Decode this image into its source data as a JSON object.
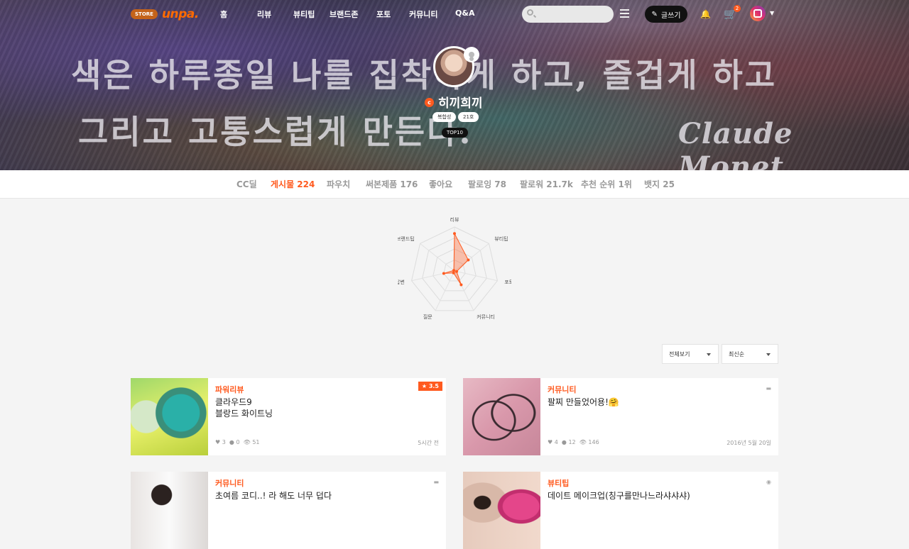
{
  "header": {
    "estore": "STORE",
    "logo": "unpa.",
    "menu": [
      "홈",
      "리뷰",
      "뷰티팁",
      "브랜드존",
      "포토",
      "커뮤니티",
      "Q&A"
    ],
    "search_placeholder": "",
    "write_label": "글쓰기",
    "cart_count": "2"
  },
  "hero": {
    "quote_line1": "색은 하루종일 나를 집착하게 하고, 즐겁게 하고",
    "quote_line2": "그리고 고통스럽게 만든다.",
    "signature": "Claude Monet"
  },
  "profile": {
    "badge": "c",
    "name": "히끼희끼",
    "tags": [
      "복합성",
      "21호"
    ],
    "rank_tag": "TOP10"
  },
  "tabs": [
    "CC딜",
    "게시물 224",
    "파우치",
    "써본제품 176",
    "좋아요",
    "팔로잉 78",
    "팔로워 21.7k",
    "추천 순위 1위",
    "뱃지 25"
  ],
  "chart_data": {
    "type": "radar",
    "axes": [
      "리뷰",
      "뷰티팁",
      "포토",
      "커뮤니티",
      "질문",
      "답변",
      "브랜드팁"
    ],
    "values": [
      0.85,
      0.4,
      0.05,
      0.35,
      0.05,
      0.25,
      0.0
    ],
    "color": "#ff5a1f"
  },
  "filters": {
    "view": "전체보기",
    "sort": "최신순"
  },
  "posts": [
    {
      "category": "파워리뷰",
      "title1": "클라우드9",
      "title2": "블랑드 화이트닝",
      "rating": "★ 3.5",
      "likes": "3",
      "comments": "0",
      "views": "51",
      "date": "5시간 전"
    },
    {
      "category": "커뮤니티",
      "title1": "팔찌 만들었어용!🤗",
      "title2": "",
      "likes": "4",
      "comments": "12",
      "views": "146",
      "date": "2016년 5월 20일"
    },
    {
      "category": "커뮤니티",
      "title1": "초여름 코디..! 라 해도 너무 덥다",
      "title2": ""
    },
    {
      "category": "뷰티팁",
      "title1": "데이트 메이크업(칭구를만나느라샤샤샤)",
      "title2": ""
    }
  ]
}
